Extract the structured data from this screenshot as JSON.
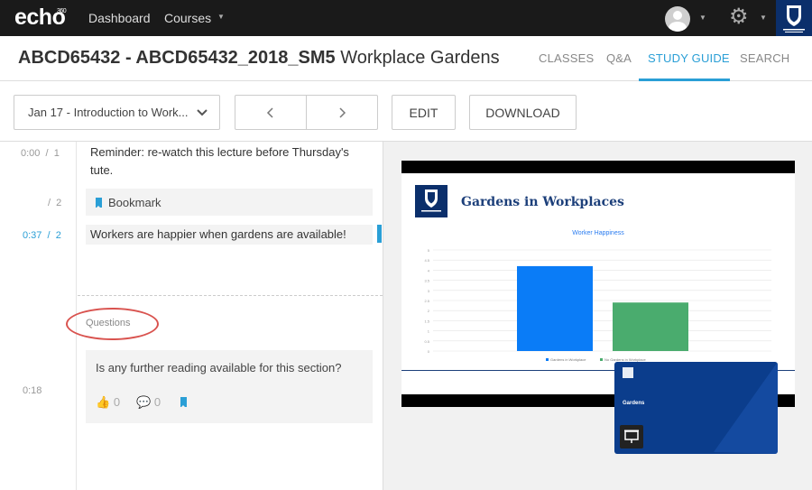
{
  "app": {
    "logo": "echo",
    "logo_sup": "360",
    "nav": {
      "dashboard": "Dashboard",
      "courses": "Courses"
    }
  },
  "course": {
    "code": "ABCD65432 - ABCD65432_2018_SM5",
    "name": "Workplace Gardens"
  },
  "tabs": [
    {
      "label": "CLASSES"
    },
    {
      "label": "Q&A"
    },
    {
      "label": "STUDY GUIDE",
      "active": true
    },
    {
      "label": "SEARCH"
    }
  ],
  "toolbar": {
    "lesson_select": "Jan 17 - Introduction to Work...",
    "edit_label": "EDIT",
    "download_label": "DOWNLOAD"
  },
  "notes": [
    {
      "time": "0:00",
      "slide": "1",
      "text_line1": "Reminder: re-watch this lecture before Thursday's",
      "text_line2": "tute."
    },
    {
      "time": "",
      "slide": "2",
      "text": "Bookmark"
    },
    {
      "time": "0:37",
      "slide": "2",
      "text": "Workers are happier when gardens are available!"
    }
  ],
  "questions": {
    "label": "Questions",
    "time": "0:18",
    "text": "Is any further reading available for this section?",
    "likes": "0",
    "comments": "0"
  },
  "slide": {
    "title": "Gardens in Workplaces",
    "pip_title": "Gardens"
  },
  "chart_data": {
    "type": "bar",
    "title": "Worker Happiness",
    "categories": [
      "Gardens in Workplace",
      "No Gardens in Workplace"
    ],
    "values": [
      4.2,
      2.4
    ],
    "colors": [
      "#0a7cf7",
      "#4aac6e"
    ],
    "ylim": [
      0,
      5
    ],
    "yticks": [
      "0",
      "0.5",
      "1",
      "1.5",
      "2",
      "2.5",
      "3",
      "3.5",
      "4",
      "4.5",
      "5"
    ]
  },
  "colors": {
    "accent": "#2a9fd6",
    "annotation": "#d9534f",
    "brand_navy": "#0b2f6b"
  }
}
